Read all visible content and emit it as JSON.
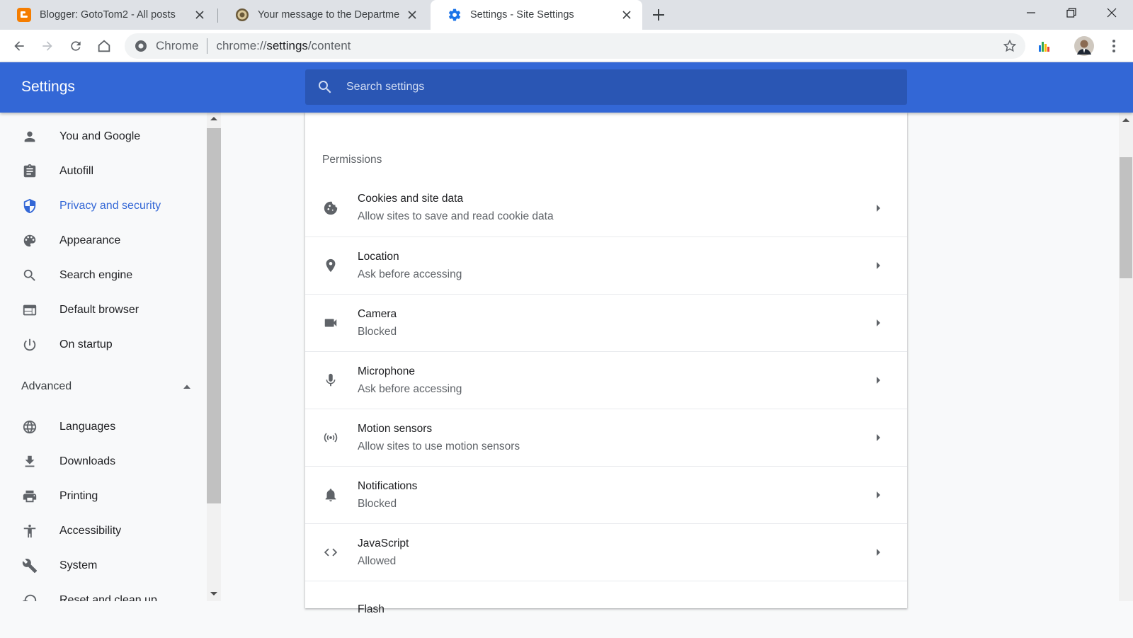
{
  "tabs": [
    {
      "title": "Blogger: GotoTom2 - All posts",
      "icon": "blogger-icon"
    },
    {
      "title": "Your message to the Department",
      "icon": "seal-icon"
    },
    {
      "title": "Settings - Site Settings",
      "icon": "gear-icon"
    }
  ],
  "omnibox": {
    "site_label": "Chrome",
    "url_prefix": "chrome://",
    "url_host": "settings",
    "url_path": "/content"
  },
  "header": {
    "title": "Settings",
    "search_placeholder": "Search settings"
  },
  "sidebar": {
    "items": [
      {
        "label": "You and Google",
        "icon": "person-icon"
      },
      {
        "label": "Autofill",
        "icon": "clipboard-icon"
      },
      {
        "label": "Privacy and security",
        "icon": "shield-icon",
        "active": true
      },
      {
        "label": "Appearance",
        "icon": "palette-icon"
      },
      {
        "label": "Search engine",
        "icon": "search-icon"
      },
      {
        "label": "Default browser",
        "icon": "browser-icon"
      },
      {
        "label": "On startup",
        "icon": "power-icon"
      }
    ],
    "advanced_label": "Advanced",
    "advanced_items": [
      {
        "label": "Languages",
        "icon": "globe-icon"
      },
      {
        "label": "Downloads",
        "icon": "download-icon"
      },
      {
        "label": "Printing",
        "icon": "printer-icon"
      },
      {
        "label": "Accessibility",
        "icon": "accessibility-icon"
      },
      {
        "label": "System",
        "icon": "wrench-icon"
      },
      {
        "label": "Reset and clean up",
        "icon": "restore-icon"
      }
    ]
  },
  "main": {
    "section_title": "Permissions",
    "rows": [
      {
        "title": "Cookies and site data",
        "subtitle": "Allow sites to save and read cookie data",
        "icon": "cookie-icon"
      },
      {
        "title": "Location",
        "subtitle": "Ask before accessing",
        "icon": "location-pin-icon"
      },
      {
        "title": "Camera",
        "subtitle": "Blocked",
        "icon": "camera-icon"
      },
      {
        "title": "Microphone",
        "subtitle": "Ask before accessing",
        "icon": "microphone-icon"
      },
      {
        "title": "Motion sensors",
        "subtitle": "Allow sites to use motion sensors",
        "icon": "sensor-icon"
      },
      {
        "title": "Notifications",
        "subtitle": "Blocked",
        "icon": "bell-icon"
      },
      {
        "title": "JavaScript",
        "subtitle": "Allowed",
        "icon": "code-icon"
      },
      {
        "title": "Flash",
        "subtitle": "",
        "icon": "puzzle-icon"
      }
    ]
  },
  "colors": {
    "header_blue": "#3367d6",
    "search_blue": "#2a56b4",
    "active_nav": "#3367d6",
    "blogger_orange": "#f57d00"
  }
}
